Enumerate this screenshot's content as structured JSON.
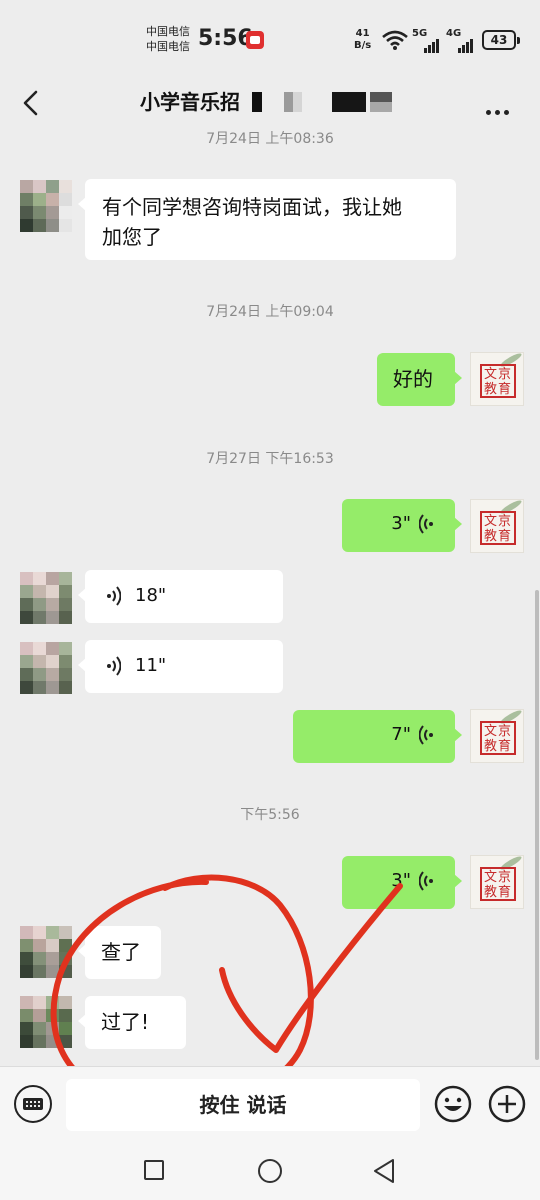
{
  "status_bar": {
    "carrier_1": "中国电信",
    "carrier_2": "中国电信",
    "time": "5:56",
    "net_speed_value": "41",
    "net_speed_unit": "B/s",
    "sig_a": "5G",
    "sig_b": "4G",
    "battery": "43"
  },
  "header": {
    "title": "小学音乐招"
  },
  "messages": [
    {
      "id": "t1",
      "type": "time",
      "text": "7月24日 上午08:36"
    },
    {
      "id": "m1",
      "type": "text",
      "side": "in",
      "text_line1": "有个同学想咨询特岗面试，我让她",
      "text_line2": "加您了"
    },
    {
      "id": "t2",
      "type": "time",
      "text": "7月24日 上午09:04"
    },
    {
      "id": "m2",
      "type": "text",
      "side": "out",
      "text": "好的"
    },
    {
      "id": "t3",
      "type": "time",
      "text": "7月27日 下午16:53"
    },
    {
      "id": "m3",
      "type": "voice",
      "side": "out",
      "duration": "3\""
    },
    {
      "id": "m4",
      "type": "voice",
      "side": "in",
      "duration": "18\""
    },
    {
      "id": "m5",
      "type": "voice",
      "side": "in",
      "duration": "11\""
    },
    {
      "id": "m6",
      "type": "voice",
      "side": "out",
      "duration": "7\""
    },
    {
      "id": "t4",
      "type": "time",
      "text": "下午5:56"
    },
    {
      "id": "m7",
      "type": "voice",
      "side": "out",
      "duration": "3\""
    },
    {
      "id": "m8",
      "type": "text",
      "side": "in",
      "text": "查了"
    },
    {
      "id": "m9",
      "type": "text",
      "side": "in",
      "text": "过了!"
    }
  ],
  "brand_avatar": {
    "line1": "文京",
    "line2": "教育"
  },
  "input_bar": {
    "hold_to_talk": "按住 说话"
  },
  "icons": {
    "back": "chevron-left-icon",
    "more": "more-dots-icon",
    "keyboard": "keyboard-icon",
    "emoji": "emoji-icon",
    "plus": "plus-icon",
    "voice_wave": "voice-wave-icon"
  },
  "colors": {
    "background": "#ededed",
    "outgoing_bubble": "#95ec69",
    "incoming_bubble": "#ffffff",
    "timestamp": "#8a8a8a",
    "annotation": "#e0321e",
    "seal": "#c62b2b"
  }
}
